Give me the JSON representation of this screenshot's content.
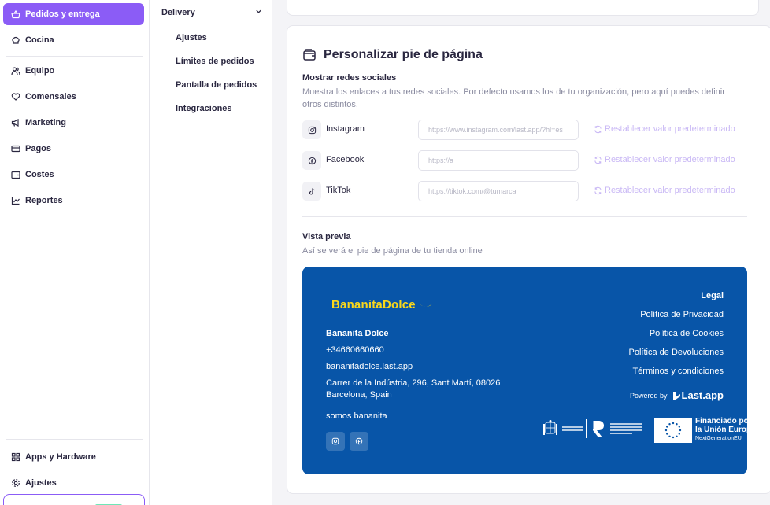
{
  "sidebar": {
    "items": [
      {
        "label": "Pedidos y entrega",
        "icon": "basket-icon"
      },
      {
        "label": "Cocina",
        "icon": "chef-hat-icon"
      },
      {
        "label": "Equipo",
        "icon": "users-icon"
      },
      {
        "label": "Comensales",
        "icon": "heart-hand-icon"
      },
      {
        "label": "Marketing",
        "icon": "megaphone-icon"
      },
      {
        "label": "Pagos",
        "icon": "credit-card-icon"
      },
      {
        "label": "Costes",
        "icon": "wallet-icon"
      },
      {
        "label": "Reportes",
        "icon": "chart-icon"
      }
    ],
    "bottom_items": [
      {
        "label": "Apps y Hardware",
        "icon": "apps-icon"
      },
      {
        "label": "Ajustes",
        "icon": "gear-icon"
      }
    ],
    "active_color": "#8b5cf6"
  },
  "subnav": {
    "header": "Delivery",
    "items": [
      "Ajustes",
      "Límites de pedidos",
      "Pantalla de pedidos",
      "Integraciones"
    ]
  },
  "footer_settings": {
    "title": "Personalizar pie de página",
    "social_label": "Mostrar redes sociales",
    "social_desc_1": "Muestra los enlaces a tus redes sociales. Por defecto usamos los de tu organización, pero aquí puedes definir",
    "social_desc_2": "otros distintos.",
    "socials": [
      {
        "name": "Instagram",
        "placeholder": "https://www.instagram.com/last.app/?hl=es",
        "reset": "Restablecer valor predeterminado"
      },
      {
        "name": "Facebook",
        "placeholder": "https://a",
        "reset": "Restablecer valor predeterminado"
      },
      {
        "name": "TikTok",
        "placeholder": "https://tiktok.com/@tumarca",
        "reset": "Restablecer valor predeterminado"
      }
    ],
    "preview_label": "Vista previa",
    "preview_desc": "Así se verá el pie de página de tu tienda online"
  },
  "preview": {
    "brand": "BananitaDolce",
    "name": "Bananita Dolce",
    "phone": "+34660660660",
    "website": "bananitadolce.last.app",
    "address_1": "Carrer de la Indústria, 296, Sant Martí, 08026",
    "address_2": "Barcelona, Spain",
    "tagline": "somos bananita",
    "legal_title": "Legal",
    "legal_links": [
      "Política de Privacidad",
      "Política de Cookies",
      "Política de Devoluciones",
      "Términos y condiciones"
    ],
    "powered_by": "Powered by",
    "powered_logo": "Last.app",
    "eu_line_1": "Financiado por",
    "eu_line_2": "la Unión Europea",
    "eu_line_3": "NextGenerationEU",
    "bg_color": "#0855a8",
    "brand_color": "#f9d71c"
  }
}
